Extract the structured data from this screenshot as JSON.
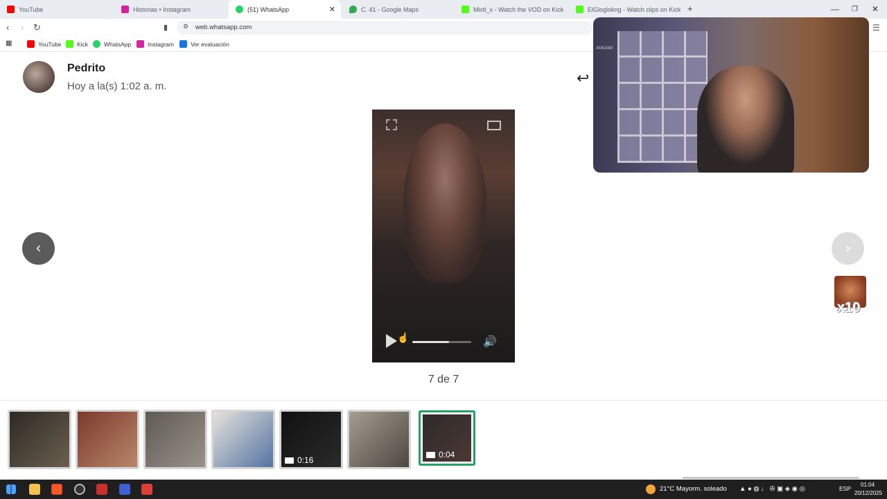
{
  "browser": {
    "tabs": [
      {
        "label": "YouTube",
        "color": "#ff0000"
      },
      {
        "label": "Historias • Instagram",
        "color": "#d6249f"
      },
      {
        "label": "(51) WhatsApp",
        "color": "#25d366",
        "active": true
      },
      {
        "label": "C. 41 - Google Maps",
        "color": "#34a853"
      },
      {
        "label": "Mixti_x - Watch the VOD on Kick",
        "color": "#53fc18"
      },
      {
        "label": "ElGloglokng - Watch clips on Kick",
        "color": "#53fc18"
      }
    ],
    "new_tab": "+",
    "url": "web.whatsapp.com",
    "bookmarks": [
      {
        "label": "YouTube",
        "color": "#ff0000"
      },
      {
        "label": "Kick",
        "color": "#53fc18"
      },
      {
        "label": "WhatsApp",
        "color": "#25d366"
      },
      {
        "label": "Instagram",
        "color": "#d6249f"
      },
      {
        "label": "Ver evaluación",
        "color": "#1a73e8"
      }
    ]
  },
  "status": {
    "contact_name": "Pedrito",
    "timestamp": "Hoy a la(s) 1:02 a. m.",
    "counter": "7 de 7",
    "video_progress": 0.62
  },
  "sticker": {
    "label": "x10"
  },
  "thumbnails": [
    {
      "colors": [
        "#2d2a24",
        "#6b5f4f"
      ],
      "duration": ""
    },
    {
      "colors": [
        "#7c3a2c",
        "#b8866a"
      ],
      "duration": ""
    },
    {
      "colors": [
        "#5e5a55",
        "#9a928a"
      ],
      "duration": ""
    },
    {
      "colors": [
        "#e6e2dc",
        "#5474a2"
      ],
      "duration": ""
    },
    {
      "colors": [
        "#111111",
        "#2a2a2a"
      ],
      "duration": "0:16"
    },
    {
      "colors": [
        "#a39d92",
        "#4d4740"
      ],
      "duration": ""
    },
    {
      "colors": [
        "#2f2a29",
        "#4a3835"
      ],
      "duration": "0:04",
      "selected": true
    }
  ],
  "taskbar": {
    "weather": "21°C  Mayorm. soleado",
    "lang": "ESP",
    "time": "01:04",
    "date": "20/12/2025"
  },
  "webcam_label": "AMOAMI"
}
